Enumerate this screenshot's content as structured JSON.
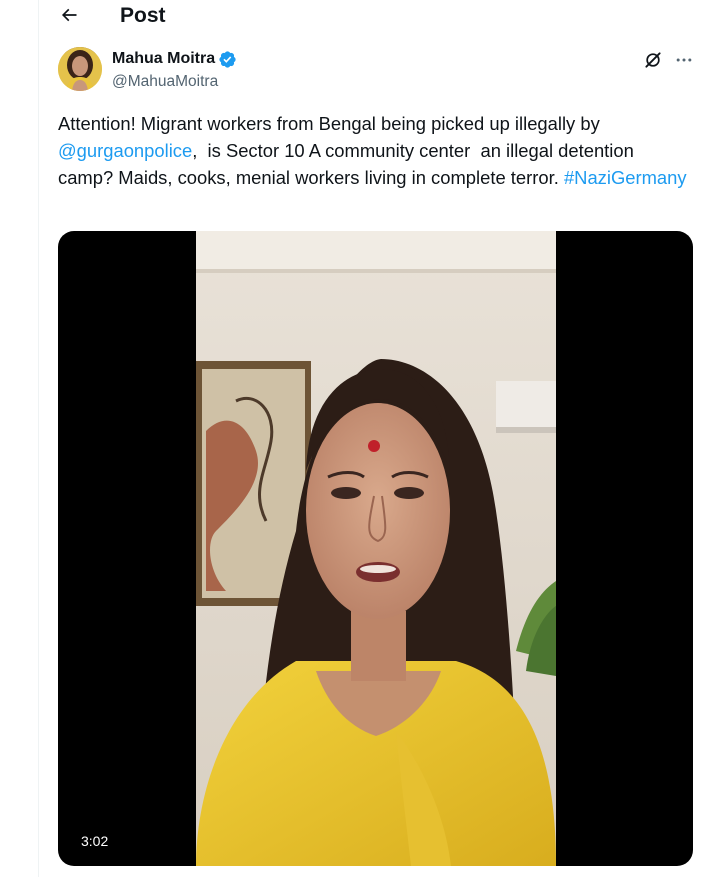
{
  "header": {
    "title": "Post",
    "back_icon": "arrow-left-icon"
  },
  "author": {
    "name": "Mahua Moitra",
    "handle": "@MahuaMoitra",
    "verified": true,
    "verified_color": "#1d9bf0"
  },
  "actions": {
    "grok_icon": "grok-icon",
    "more_icon": "more-horizontal-icon"
  },
  "tweet": {
    "text_part1": "Attention! Migrant workers from Bengal being picked up illegally by ",
    "mention": "@gurgaonpolice",
    "text_part2": ",  is Sector 10 A community center  an illegal detention camp? Maids, cooks, menial workers living in complete terror. ",
    "hashtag": "#NaziGermany",
    "link_color": "#1d9bf0"
  },
  "video": {
    "duration": "3:02"
  }
}
